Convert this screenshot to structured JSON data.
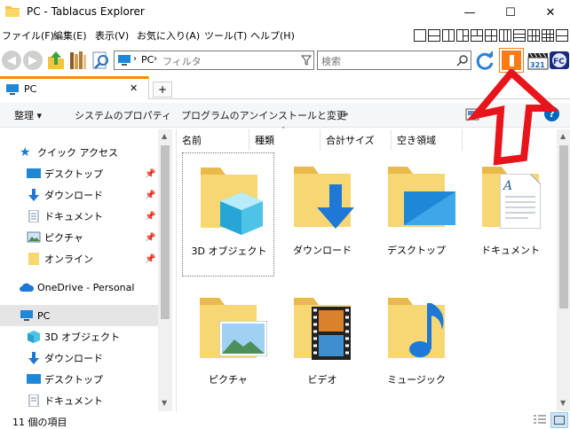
{
  "window": {
    "title": "PC - Tablacus Explorer",
    "minimize": "—",
    "maximize": "☐",
    "close": "✕"
  },
  "menu": {
    "items": [
      "ファイル(F)",
      "編集(E)",
      "表示(V)",
      "お気に入り(A)",
      "ツール(T)",
      "ヘルプ(H)"
    ]
  },
  "toolbar": {
    "address_path": "PC",
    "filter_placeholder": "フィルタ",
    "search_placeholder": "検索"
  },
  "tabs": [
    {
      "label": "PC",
      "close": "✕"
    }
  ],
  "new_tab": "+",
  "commandbar": {
    "organize": "整理 ▾",
    "system_properties": "システムのプロパティ",
    "uninstall": "プログラムのアンインストールと変更",
    "more": "»",
    "help": "?"
  },
  "sidebar": {
    "quick_access": "クイック アクセス",
    "items": [
      {
        "label": "デスクトップ",
        "pinned": true
      },
      {
        "label": "ダウンロード",
        "pinned": true
      },
      {
        "label": "ドキュメント",
        "pinned": true
      },
      {
        "label": "ピクチャ",
        "pinned": true
      },
      {
        "label": "オンライン",
        "pinned": true
      }
    ],
    "onedrive": "OneDrive - Personal",
    "pc": "PC",
    "pc_children": [
      "3D オブジェクト",
      "ダウンロード",
      "デスクトップ",
      "ドキュメント"
    ]
  },
  "columns": [
    "名前",
    "種類",
    "合計サイズ",
    "空き領域"
  ],
  "folders": [
    {
      "label": "3D オブジェクト",
      "icon": "cube-3d"
    },
    {
      "label": "ダウンロード",
      "icon": "download-arrow"
    },
    {
      "label": "デスクトップ",
      "icon": "desktop-screen"
    },
    {
      "label": "ドキュメント",
      "icon": "document-page"
    },
    {
      "label": "ピクチャ",
      "icon": "picture"
    },
    {
      "label": "ビデオ",
      "icon": "film-strip"
    },
    {
      "label": "ミュージック",
      "icon": "music-note"
    }
  ],
  "status": {
    "item_count": "11 個の項目"
  },
  "colors": {
    "accent_orange": "#ff8c00",
    "folder_yellow": "#f7d774",
    "selection_gray": "#e5e5e5",
    "annotation_red": "#e8141b",
    "link_blue": "#0067c0"
  }
}
